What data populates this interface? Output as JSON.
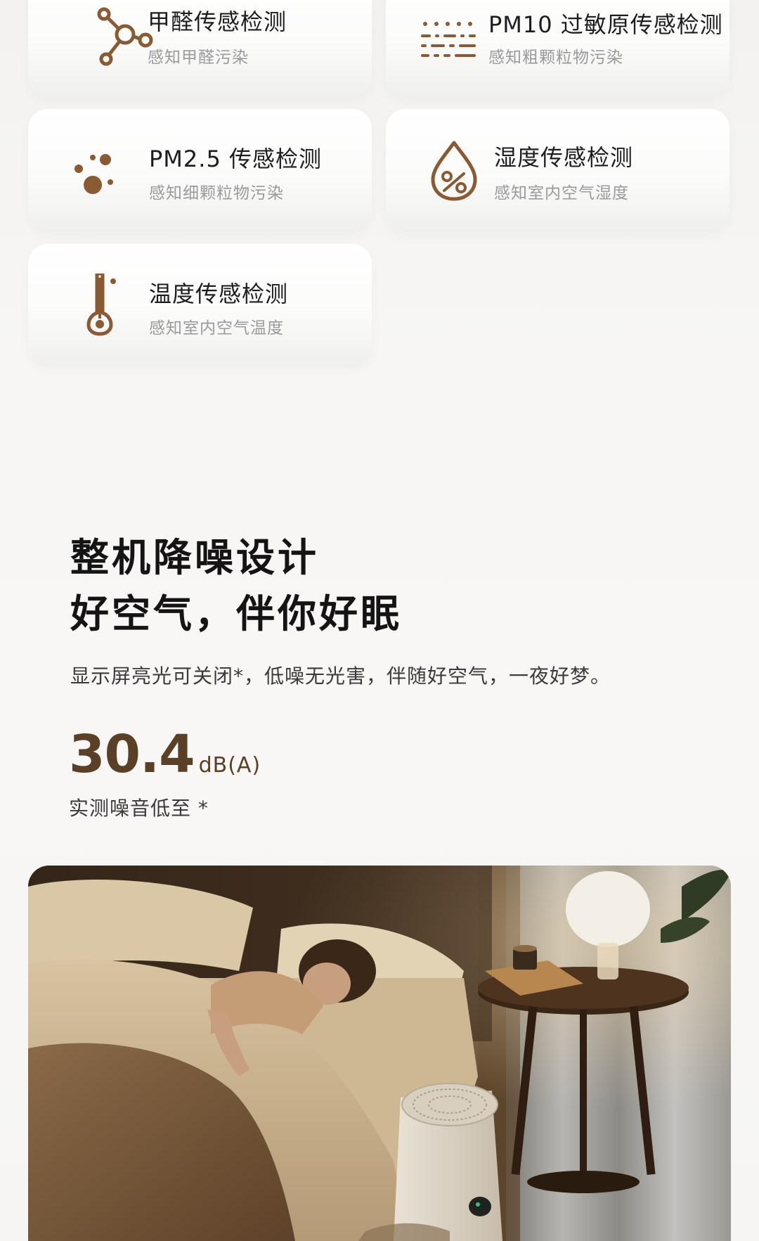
{
  "sensors": [
    {
      "title": "甲醛传感检测",
      "subtitle": "感知甲醛污染",
      "icon": "molecule-icon"
    },
    {
      "title": "PM10 过敏原传感检测",
      "subtitle": "感知粗颗粒物污染",
      "icon": "dotted-lines-icon"
    },
    {
      "title": "PM2.5 传感检测",
      "subtitle": "感知细颗粒物污染",
      "icon": "particles-icon"
    },
    {
      "title": "湿度传感检测",
      "subtitle": "感知室内空气湿度",
      "icon": "humidity-drop-icon"
    },
    {
      "title": "温度传感检测",
      "subtitle": "感知室内空气温度",
      "icon": "thermometer-icon"
    }
  ],
  "noise": {
    "heading_line1": "整机降噪设计",
    "heading_line2": "好空气，伴你好眠",
    "description": "显示屏亮光可关闭*，低噪无光害，伴随好空气，一夜好梦。",
    "value": "30.4",
    "unit": "dB(A)",
    "label": "实测噪音低至 *"
  },
  "colors": {
    "icon_brown": "#8a5a34",
    "stat_brown": "#5a4026"
  }
}
